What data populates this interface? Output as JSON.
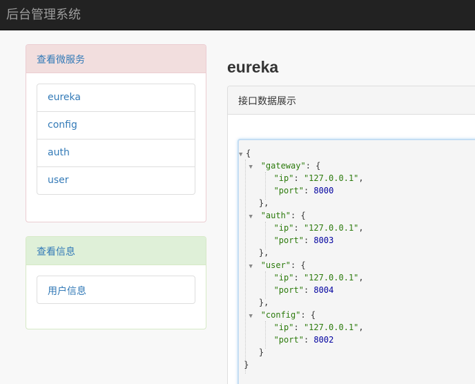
{
  "app": {
    "title": "后台管理系统"
  },
  "services_panel": {
    "heading": "查看微服务",
    "items": [
      "eureka",
      "config",
      "auth",
      "user"
    ]
  },
  "info_panel": {
    "heading": "查看信息",
    "items": [
      "用户信息"
    ]
  },
  "main": {
    "title": "eureka",
    "panel_heading": "接口数据展示",
    "json": {
      "open": "{",
      "close": "}",
      "services": [
        {
          "key": "\"gateway\"",
          "ip": "\"127.0.0.1\"",
          "port": "8000"
        },
        {
          "key": "\"auth\"",
          "ip": "\"127.0.0.1\"",
          "port": "8003"
        },
        {
          "key": "\"user\"",
          "ip": "\"127.0.0.1\"",
          "port": "8004"
        },
        {
          "key": "\"config\"",
          "ip": "\"127.0.0.1\"",
          "port": "8002"
        }
      ],
      "ip_key": "\"ip\"",
      "port_key": "\"port\""
    }
  },
  "colors": {
    "navbar": "#222222",
    "link": "#337ab7",
    "json_string": "#2b7a0b",
    "json_number": "#00009f"
  }
}
